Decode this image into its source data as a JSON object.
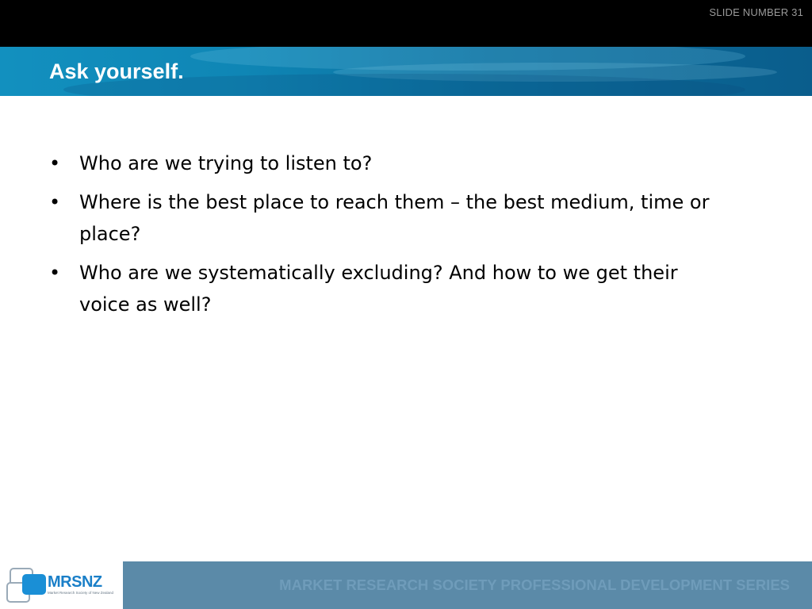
{
  "header": {
    "slide_number": "SLIDE NUMBER 31"
  },
  "title": "Ask yourself.",
  "bullets": [
    {
      "marker": "•",
      "text": "Who are we trying to listen to?"
    },
    {
      "marker": "•",
      "text": "Where is the best place to reach them – the best medium, time or place?"
    },
    {
      "marker": "•",
      "text": "Who are we systematically excluding? And how to we get their voice as well?"
    }
  ],
  "footer": {
    "logo_text": "MRSNZ",
    "logo_subtext": "Market Research Society of New Zealand",
    "series_text": "MARKET RESEARCH SOCIETY PROFESSIONAL DEVELOPMENT SERIES"
  },
  "colors": {
    "top_bar": "#000000",
    "title_band": "#0f86b5",
    "footer_bar": "#5b8aa8",
    "logo_blue": "#1a8fd6"
  }
}
